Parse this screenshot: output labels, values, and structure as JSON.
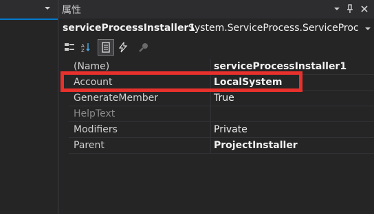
{
  "panel": {
    "title": "属性"
  },
  "object_selector": {
    "name": "serviceProcessInstaller1",
    "type": "System.ServiceProcess.ServiceProc"
  },
  "properties": [
    {
      "name": "(Name)",
      "value": "serviceProcessInstaller1",
      "bold": true
    },
    {
      "name": "Account",
      "value": "LocalSystem",
      "bold": true
    },
    {
      "name": "GenerateMember",
      "value": "True",
      "bold": false
    },
    {
      "name": "HelpText",
      "value": "",
      "bold": false,
      "dim": true
    },
    {
      "name": "Modifiers",
      "value": "Private",
      "bold": false
    },
    {
      "name": "Parent",
      "value": "ProjectInstaller",
      "bold": true
    }
  ],
  "colors": {
    "highlight": "#e8312c",
    "accent": "#007acc"
  },
  "icons": [
    "dropdown-icon",
    "pin-icon",
    "close-icon",
    "categorized-icon",
    "alphabetical-icon",
    "properties-icon",
    "events-icon",
    "property-pages-icon"
  ]
}
